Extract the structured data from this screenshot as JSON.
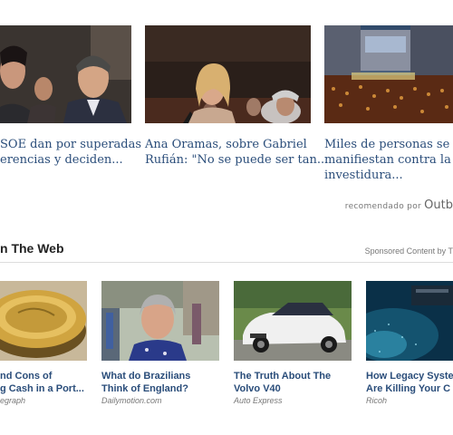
{
  "recommended": {
    "items": [
      {
        "title_line1": "SOE dan por superadas",
        "title_line2": "erencias y deciden...",
        "image": "politicians-photo"
      },
      {
        "title_line1": "Ana Oramas, sobre Gabriel",
        "title_line2": "Rufián: \"No se puede ser tan...",
        "image": "woman-parliament-photo"
      },
      {
        "title_line1": "Miles de personas se",
        "title_line2": "manifiestan contra la",
        "title_line3": "investidura...",
        "image": "crowd-protest-photo"
      }
    ],
    "attribution_prefix": "recomendado por",
    "attribution_logo": "Outb"
  },
  "from_web": {
    "heading": "n The Web",
    "sponsored_label": "Sponsored Content by T",
    "items": [
      {
        "title_line1": "nd Cons of",
        "title_line2": "g Cash in a Port...",
        "source": "egraph",
        "image": "gold-coin-photo"
      },
      {
        "title_line1": "What do Brazilians",
        "title_line2": "Think of England?",
        "source": "Dailymotion.com",
        "image": "street-woman-photo"
      },
      {
        "title_line1": "The Truth About The",
        "title_line2": "Volvo V40",
        "source": "Auto Express",
        "image": "white-car-photo"
      },
      {
        "title_line1": "How Legacy Syste",
        "title_line2": "Are Killing Your C",
        "source": "Ricoh",
        "image": "tech-blue-photo"
      }
    ]
  },
  "colors": {
    "link": "#2a4d7a",
    "muted": "#777777"
  }
}
